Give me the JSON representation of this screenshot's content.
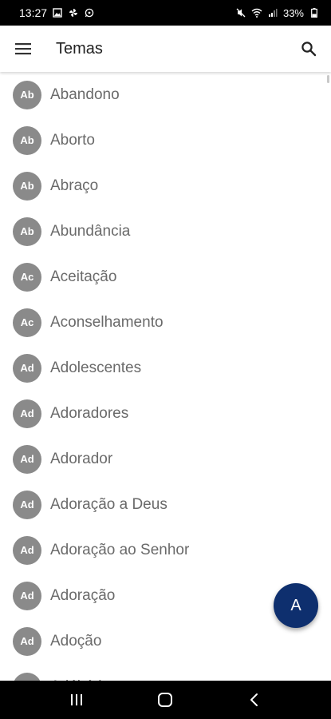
{
  "status_bar": {
    "time": "13:27",
    "battery": "33%",
    "icons_left": [
      "image-icon",
      "pinwheel-icon",
      "whatsapp-icon"
    ],
    "icons_right": [
      "mute-icon",
      "wifi-icon",
      "signal-icon",
      "battery-icon"
    ]
  },
  "app_bar": {
    "title": "Temas",
    "menu_icon": "hamburger-menu-icon",
    "search_icon": "search-icon"
  },
  "list": {
    "items": [
      {
        "avatar": "Ab",
        "label": "Abandono"
      },
      {
        "avatar": "Ab",
        "label": "Aborto"
      },
      {
        "avatar": "Ab",
        "label": "Abraço"
      },
      {
        "avatar": "Ab",
        "label": "Abundância"
      },
      {
        "avatar": "Ac",
        "label": "Aceitação"
      },
      {
        "avatar": "Ac",
        "label": "Aconselhamento"
      },
      {
        "avatar": "Ad",
        "label": "Adolescentes"
      },
      {
        "avatar": "Ad",
        "label": "Adoradores"
      },
      {
        "avatar": "Ad",
        "label": "Adorador"
      },
      {
        "avatar": "Ad",
        "label": "Adoração a Deus"
      },
      {
        "avatar": "Ad",
        "label": "Adoração ao Senhor"
      },
      {
        "avatar": "Ad",
        "label": "Adoração"
      },
      {
        "avatar": "Ad",
        "label": "Adoção"
      },
      {
        "avatar": "Ad",
        "label": "Adúltério"
      }
    ]
  },
  "fab": {
    "label": "A"
  },
  "nav_bar": {
    "icons": [
      "recent-apps-icon",
      "home-icon",
      "back-icon"
    ]
  },
  "colors": {
    "avatar_bg": "#8a8a8a",
    "fab_bg": "#0e2f6e",
    "item_text": "#6a6a6a",
    "title_text": "#222222"
  }
}
